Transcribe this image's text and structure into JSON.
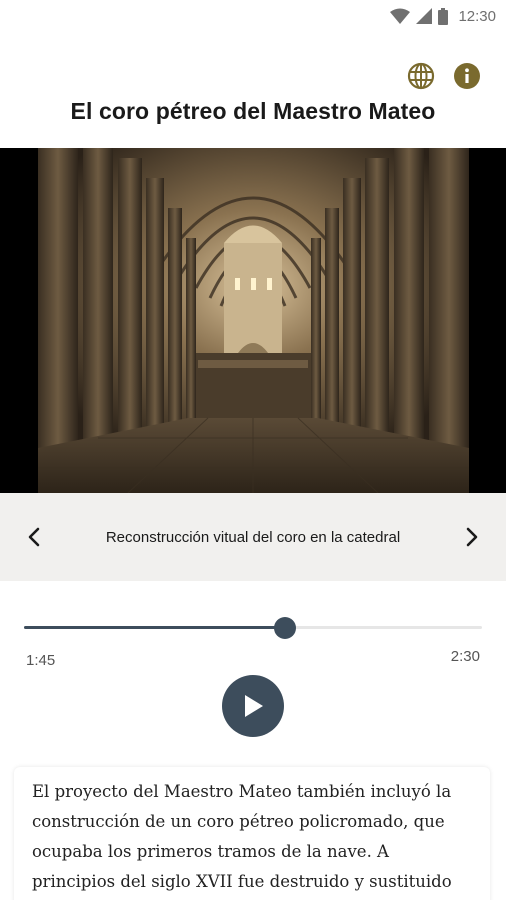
{
  "status_bar": {
    "time": "12:30",
    "icons": [
      "wifi-icon",
      "signal-icon",
      "battery-icon"
    ]
  },
  "header": {
    "actions": [
      "globe-icon",
      "info-icon"
    ],
    "title": "El coro pétreo del Maestro Mateo"
  },
  "media": {
    "description": ""
  },
  "caption": {
    "text": "Reconstrucción vitual del coro en la catedral",
    "prev_icon": "chevron-left-icon",
    "next_icon": "chevron-right-icon"
  },
  "player": {
    "current_time": "1:45",
    "total_time": "2:30",
    "progress": 0.57,
    "play_icon": "play-icon"
  },
  "description": {
    "text": "El proyecto del Maestro Mateo también incluyó la construcción de un coro pétreo policromado, que ocupaba los primeros tramos de la nave. A principios del siglo XVII fue destruido y sustituido"
  },
  "colors": {
    "accent": "#3d4d5c",
    "header_icon": "#7a6a2e",
    "caption_bg": "#f1f0ee",
    "media_bg": "#000000"
  }
}
